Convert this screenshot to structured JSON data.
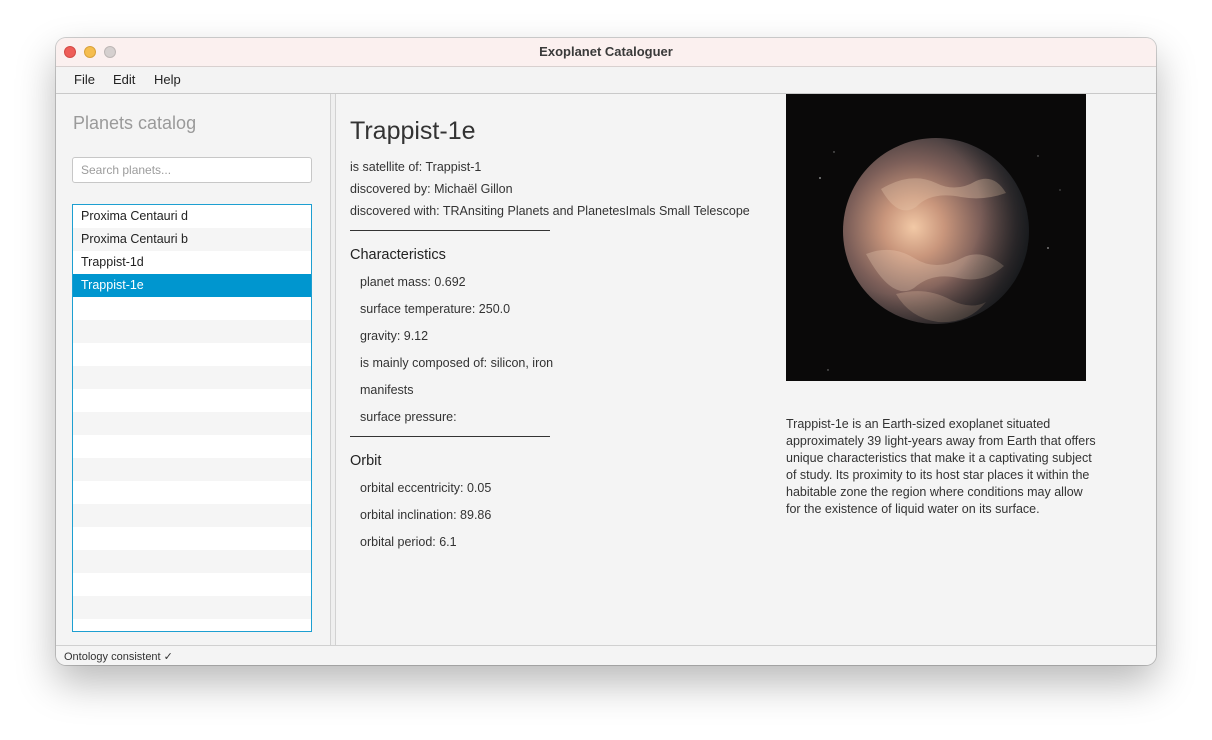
{
  "window": {
    "title": "Exoplanet Cataloguer"
  },
  "menu": {
    "items": [
      "File",
      "Edit",
      "Help"
    ]
  },
  "sidebar": {
    "title": "Planets catalog",
    "search_placeholder": "Search planets...",
    "search_value": "",
    "planets": [
      "Proxima Centauri d",
      "Proxima Centauri b",
      "Trappist-1d",
      "Trappist-1e"
    ],
    "selected": "Trappist-1e"
  },
  "planet": {
    "name": "Trappist-1e",
    "satellite_of": "is satellite of: Trappist-1",
    "discovered_by": "discovered by: Michaël Gillon",
    "discovered_with": "discovered with: TRAnsiting Planets and PlanetesImals Small Telescope",
    "characteristics_title": "Characteristics",
    "characteristics": {
      "mass": "planet mass: 0.692",
      "temperature": "surface temperature: 250.0",
      "gravity": "gravity: 9.12",
      "composition": "is mainly composed of: silicon, iron",
      "manifests": "manifests",
      "pressure": "surface pressure:"
    },
    "orbit_title": "Orbit",
    "orbit": {
      "eccentricity": "orbital eccentricity: 0.05",
      "inclination": "orbital inclination: 89.86",
      "period": "orbital period: 6.1"
    },
    "description": "Trappist-1e is an Earth-sized exoplanet situated approximately 39 light-years away from Earth that offers unique characteristics that make it a captivating subject of study. Its proximity to its host star places it within the habitable zone the region where conditions may allow for the existence of liquid water on its surface."
  },
  "status": {
    "text": "Ontology consistent ✓"
  },
  "colors": {
    "selection": "#0096cf",
    "list_border": "#1d9fd1",
    "title_bar": "#fbf0ef"
  }
}
